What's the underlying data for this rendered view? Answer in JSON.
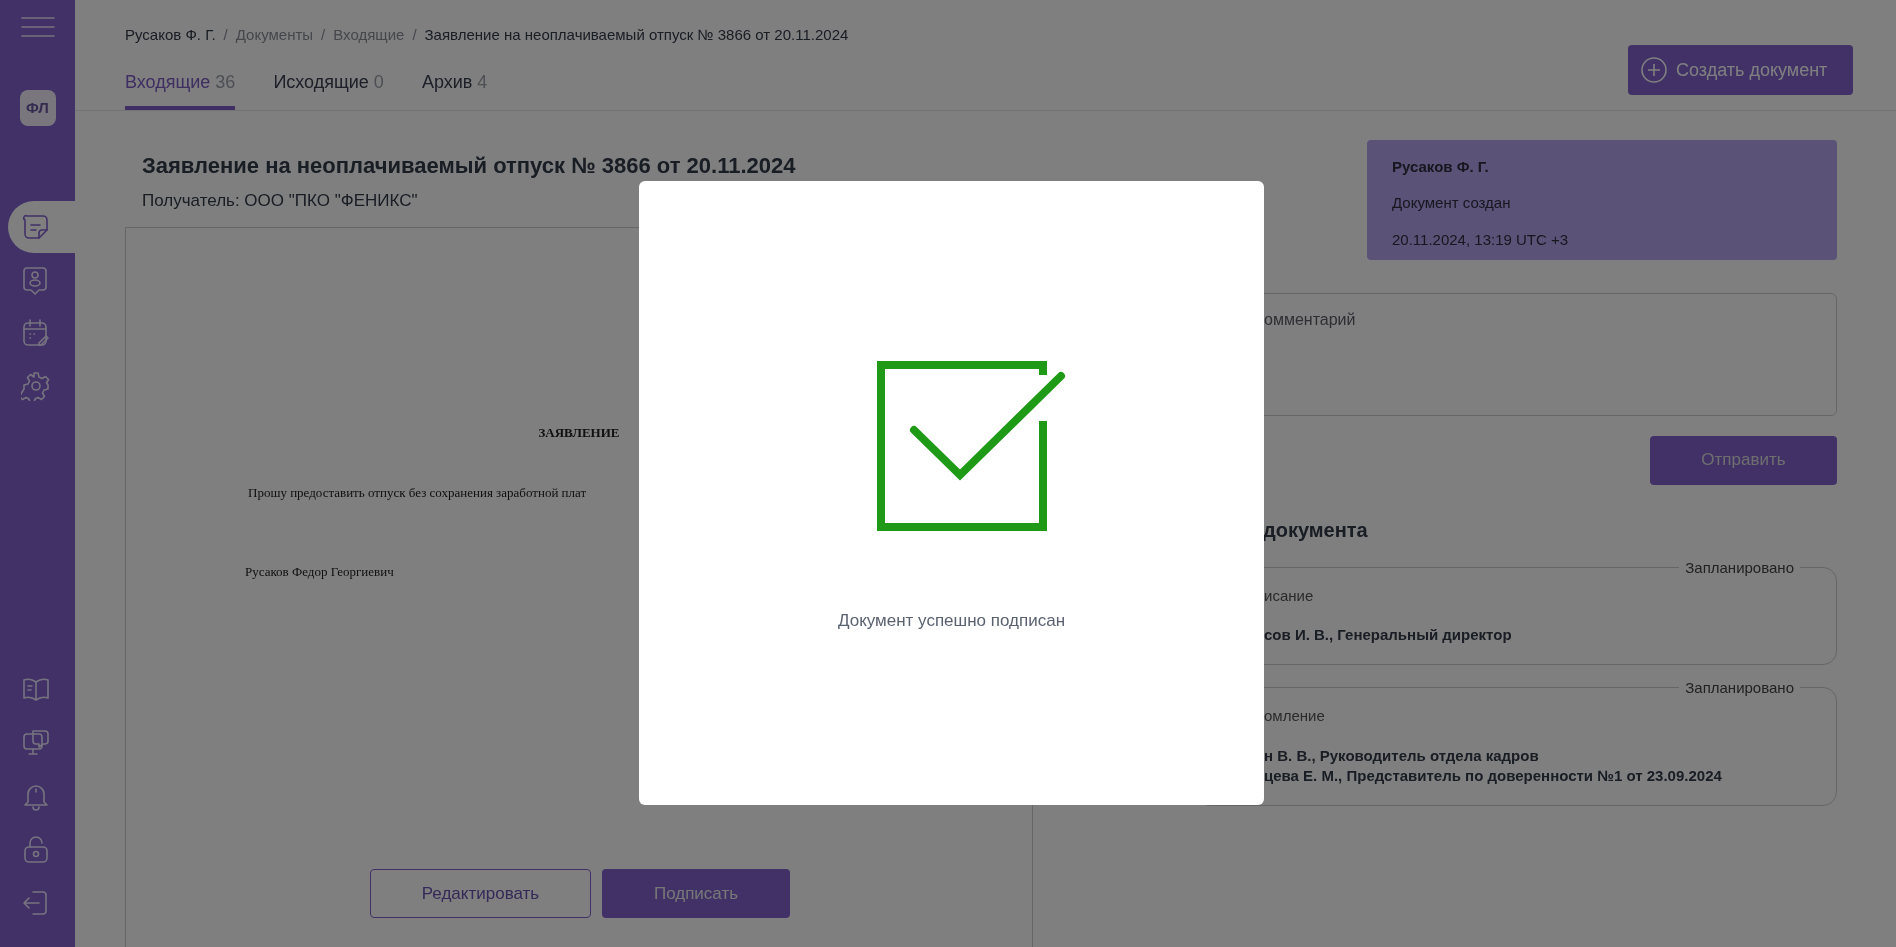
{
  "sidebar": {
    "avatar": "ФЛ",
    "nav_items": [
      {
        "selected": true
      },
      {
        "selected": false
      },
      {
        "selected": false
      },
      {
        "selected": false
      }
    ],
    "bottom_items": [
      {
        "selected": false
      },
      {
        "selected": false
      },
      {
        "selected": false
      },
      {
        "selected": false
      },
      {
        "selected": false
      }
    ]
  },
  "breadcrumb": {
    "separator": "/",
    "items": [
      {
        "label": "Русаков Ф. Г.",
        "muted": false
      },
      {
        "label": "Документы",
        "muted": true
      },
      {
        "label": "Входящие",
        "muted": true
      },
      {
        "label": "Заявление на неоплачиваемый отпуск № 3866 от 20.11.2024",
        "muted": false
      }
    ]
  },
  "tabs": [
    {
      "label": "Входящие",
      "count": "36",
      "selected": true
    },
    {
      "label": "Исходящие",
      "count": "0",
      "selected": false
    },
    {
      "label": "Архив",
      "count": "4",
      "selected": false
    }
  ],
  "create_button": "Создать документ",
  "document": {
    "title": "Заявление на неоплачиваемый отпуск № 3866 от 20.11.2024",
    "recipient": "Получатель: ООО \"ПКО \"ФЕНИКС\"",
    "preview": {
      "heading": "ЗАЯВЛЕНИЕ",
      "body": "Прошу предоставить отпуск без сохранения заработной плат",
      "signature": "Русаков Федор Георгиевич"
    },
    "buttons": [
      {
        "label": "Редактировать",
        "kind": "outline"
      },
      {
        "label": "Подписать",
        "kind": "primary"
      }
    ]
  },
  "info_card": {
    "author": "Русаков Ф. Г.",
    "event": "Документ создан",
    "time": "20.11.2024, 13:19 UTC +3"
  },
  "comment": {
    "placeholder": "омментарий"
  },
  "send_button": "Отправить",
  "route": {
    "title": "документа",
    "steps": [
      {
        "status": "Запланировано",
        "type": "исание",
        "people": [
          "сов И. В., Генеральный директор"
        ]
      },
      {
        "status": "Запланировано",
        "type": "омление",
        "people": [
          "н В. В., Руководитель отдела кадров",
          "цева Е. М., Представитель по доверенности №1 от 23.09.2024"
        ]
      }
    ]
  },
  "modal": {
    "message": "Документ успешно подписан"
  }
}
